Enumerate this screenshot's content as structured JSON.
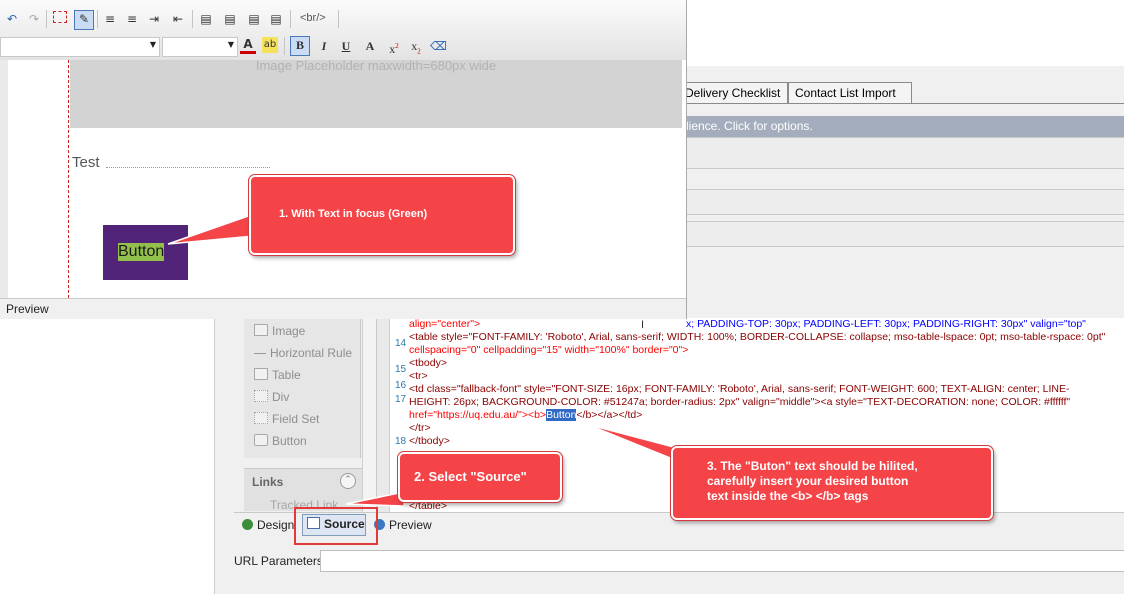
{
  "editor": {
    "tag_button": "<br/>",
    "placeholder_text": "Image Placeholder maxwidth=680px wide",
    "test_text": "Test",
    "sample_button_text": "Button",
    "status_mode": "Preview"
  },
  "back_window": {
    "tabs": [
      "Delivery Checklist",
      "Contact List Import"
    ],
    "notice": "lience. Click for options."
  },
  "sidebar": {
    "items": [
      {
        "label": "Image",
        "icon": "image-icon"
      },
      {
        "label": "Horizontal Rule",
        "icon": "horizontal-rule-icon"
      },
      {
        "label": "Table",
        "icon": "table-icon"
      },
      {
        "label": "Div",
        "icon": "div-icon"
      },
      {
        "label": "Field Set",
        "icon": "fieldset-icon"
      },
      {
        "label": "Button",
        "icon": "button-icon"
      }
    ],
    "links_header": "Links",
    "tracked_link": "Tracked Link"
  },
  "code": {
    "line_top": "x; PADDING-TOP: 30px; PADDING-LEFT: 30px; PADDING-RIGHT: 30px\" valign=\"top\"",
    "line_align": "align=\"center\">",
    "line14_no": "14",
    "line14": "<table style=\"FONT-FAMILY: 'Roboto', Arial, sans-serif; WIDTH: 100%; BORDER-COLLAPSE: collapse; mso-table-lspace: 0pt; mso-table-rspace: 0pt\"",
    "line14b": "cellspacing=\"0\" cellpadding=\"15\" width=\"100%\" border=\"0\">",
    "tbody_open": "<tbody>",
    "line15_no": "15",
    "tr_open": "<tr>",
    "line16_no": "16",
    "line16": "<td class=\"fallback-font\" style=\"FONT-SIZE: 16px; FONT-FAMILY: 'Roboto', Arial, sans-serif; FONT-WEIGHT: 600; TEXT-ALIGN: center; LINE-",
    "line17_no": "17",
    "line17": "HEIGHT: 26px; BACKGROUND-COLOR: #51247a; border-radius: 2px\" valign=\"middle\"><a style=\"TEXT-DECORATION: none; COLOR: #ffffff\"",
    "href_pre": "href=\"https://uq.edu.au/\"><b>",
    "selected_word": "Button",
    "href_post": "</b></a></td>",
    "tr_close": "</tr>",
    "line18_no": "18",
    "tbody_close": "</tbody>",
    "table_close": "</table>"
  },
  "bottom_tabs": {
    "design": "Design",
    "source": "Source",
    "preview": "Preview"
  },
  "url_parameters_label": "URL Parameters",
  "callouts": {
    "c1": "1. With Text in focus (Green)",
    "c2": "2. Select \"Source\"",
    "c3_line1": "3.  The \"Buton\" text should be hilited,",
    "c3_line2": "carefully insert your desired button",
    "c3_line3": "text inside the <b>     </b> tags"
  },
  "colors": {
    "button_bg": "#51247a",
    "button_text_highlight": "#92c04b",
    "callout": "#f44448",
    "selection": "#316ac5"
  }
}
